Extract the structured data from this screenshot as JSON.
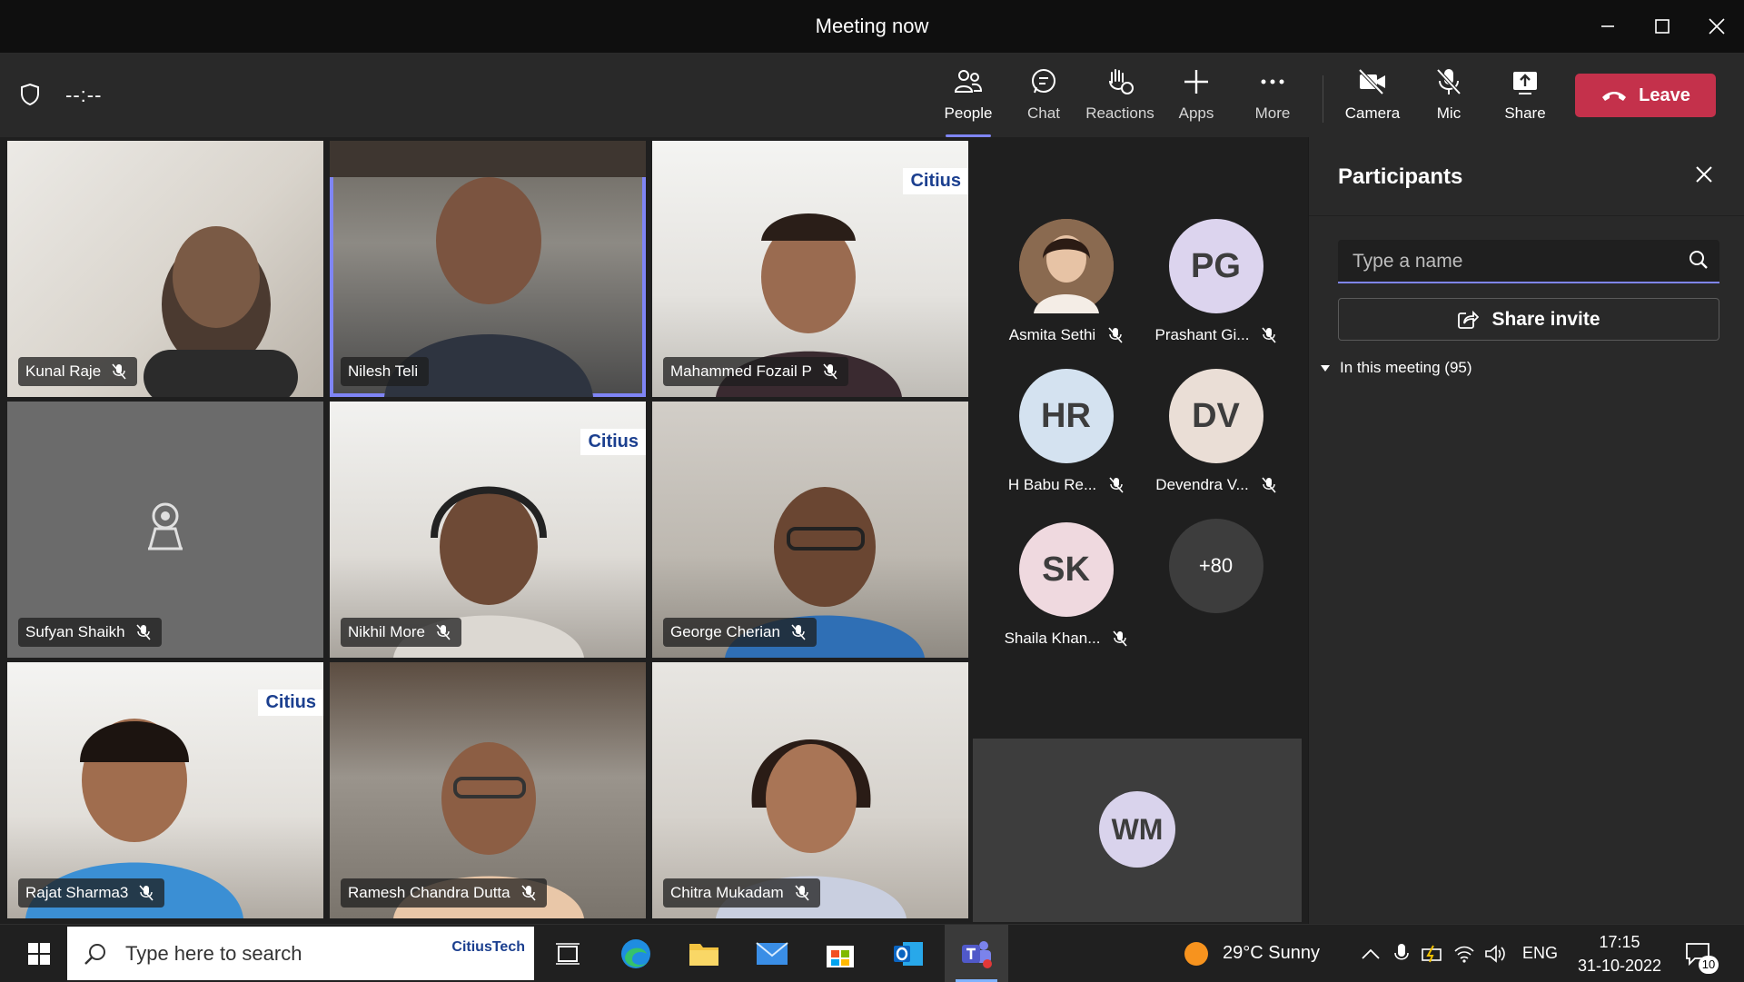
{
  "window": {
    "title": "Meeting now"
  },
  "toolbar": {
    "timer": "--:--",
    "items": [
      {
        "label": "People",
        "icon": "people-icon"
      },
      {
        "label": "Chat",
        "icon": "chat-icon"
      },
      {
        "label": "Reactions",
        "icon": "reactions-icon"
      },
      {
        "label": "Apps",
        "icon": "apps-icon"
      },
      {
        "label": "More",
        "icon": "more-icon"
      },
      {
        "label": "Camera",
        "icon": "camera-off-icon"
      },
      {
        "label": "Mic",
        "icon": "mic-off-icon"
      },
      {
        "label": "Share",
        "icon": "share-icon"
      }
    ],
    "leave_label": "Leave",
    "active_tab": "People"
  },
  "video_tiles": [
    {
      "name": "Kunal Raje",
      "muted": true
    },
    {
      "name": "Nilesh Teli",
      "muted": false,
      "speaking": true
    },
    {
      "name": "Mahammed Fozail P",
      "muted": true
    },
    {
      "name": "Sufyan Shaikh",
      "muted": true,
      "camera_off": true
    },
    {
      "name": "Nikhil More",
      "muted": true
    },
    {
      "name": "George Cherian",
      "muted": true
    },
    {
      "name": "Rajat Sharma3",
      "muted": true
    },
    {
      "name": "Ramesh Chandra Dutta",
      "muted": true
    },
    {
      "name": "Chitra Mukadam",
      "muted": true
    }
  ],
  "background_brand": "Citius",
  "avatar_participants": [
    {
      "name": "Asmita Sethi",
      "initials": "",
      "photo": true,
      "color": "#c58a5e"
    },
    {
      "name": "Prashant Gi...",
      "initials": "PG",
      "color": "#dcd4ee"
    },
    {
      "name": "H Babu Re...",
      "initials": "HR",
      "color": "#d4e2f0"
    },
    {
      "name": "Devendra V...",
      "initials": "DV",
      "color": "#eaded6"
    },
    {
      "name": "Shaila Khan...",
      "initials": "SK",
      "color": "#efd9df"
    }
  ],
  "overflow_count": "+80",
  "wm_tile": {
    "initials": "WM"
  },
  "participants_panel": {
    "title": "Participants",
    "search_placeholder": "Type a name",
    "share_invite": "Share invite",
    "in_meeting": "In this meeting (95)"
  },
  "taskbar": {
    "search_placeholder": "Type here to search",
    "search_brand": "CitiusTech",
    "weather": "29°C  Sunny",
    "language": "ENG",
    "time": "17:15",
    "date": "31-10-2022",
    "notifications": "10"
  },
  "colors": {
    "accent": "#7f85f5",
    "leave": "#c4314b",
    "panel": "#292929"
  }
}
